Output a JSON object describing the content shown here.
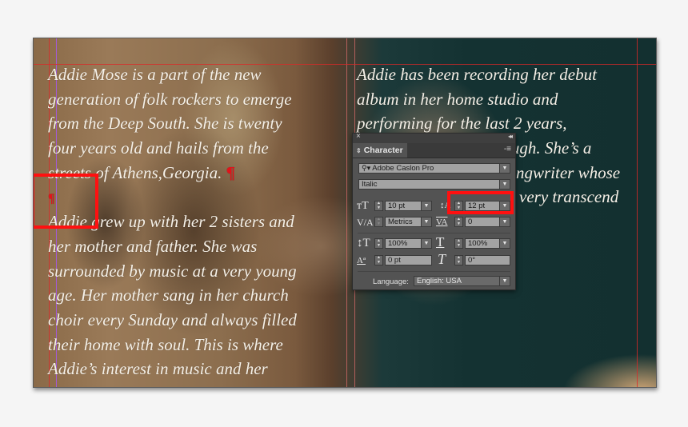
{
  "document": {
    "left_column": {
      "paragraph1": [
        "Addie Mose is a part of the new",
        "generation of folk rockers to emerge",
        "from the Deep South. She is twenty",
        "four years old and hails from the",
        "streets of Athens,Georgia."
      ],
      "paragraph2": [
        "Addie grew up with her 2 sisters and",
        "her mother and father. She was",
        "surrounded by music at a very young",
        "age. Her mother sang in her church",
        "choir every Sunday and always filled",
        "their home with soul. This is where",
        "Addie’s  interest in music and her"
      ]
    },
    "right_column": {
      "lines": [
        "Addie has been recording her debut",
        "album in her home studio and",
        "performing for the last 2 years,",
        "rough. She’s a",
        "ngwriter whose",
        "very transcend"
      ]
    },
    "pilcrow": "¶"
  },
  "character_panel": {
    "title": "Character",
    "close_glyph": "×",
    "collapse_glyph": "◂◂",
    "menu_glyph": "-≡",
    "font_family": "Adobe Caslon Pro",
    "font_style": "Italic",
    "font_size": "10 pt",
    "leading": "12 pt",
    "kerning": "Metrics",
    "tracking": "0",
    "vertical_scale": "100%",
    "horizontal_scale": "100%",
    "baseline_shift": "0 pt",
    "skew": "0°",
    "language_label": "Language:",
    "language": "English: USA"
  },
  "highlight_color": "#ff1010"
}
